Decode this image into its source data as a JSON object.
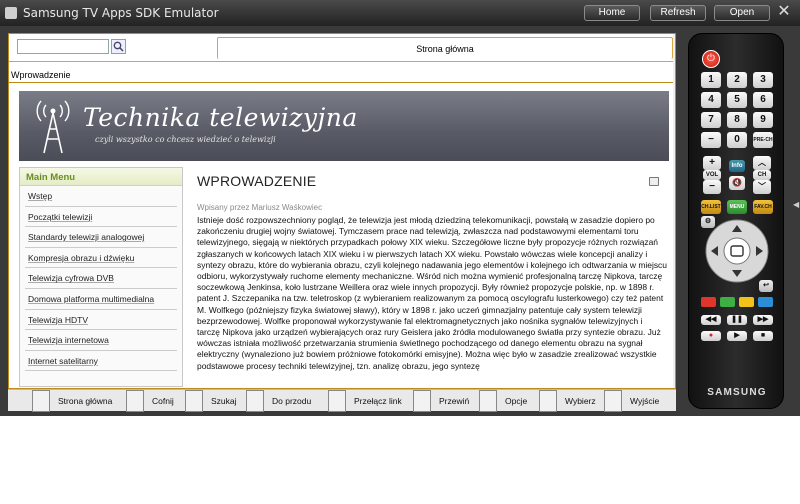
{
  "window": {
    "title": "Samsung TV Apps SDK Emulator",
    "buttons": {
      "home": "Home",
      "refresh": "Refresh",
      "open": "Open",
      "close": "✕"
    }
  },
  "browser": {
    "search": {
      "value": "",
      "placeholder": ""
    },
    "tab": "Strona główna",
    "breadcrumb": "Wprowadzenie"
  },
  "site": {
    "title": "Technika telewizyjna",
    "subtitle": "czyli wszystko co chcesz wiedzieć o telewizji",
    "menu": {
      "heading": "Main Menu",
      "items": [
        "Wstęp",
        "Początki telewizji",
        "Standardy telewizji analogowej",
        "Kompresja obrazu i dźwięku",
        "Telewizja cyfrowa DVB",
        "Domowa platforma multimedialna",
        "Telewizja HDTV",
        "Telewizja internetowa",
        "Internet satelitarny"
      ]
    },
    "article": {
      "heading": "WPROWADZENIE",
      "author": "Wpisany przez Mariusz Waśkowiec",
      "body": "Istnieje dość rozpowszechniony pogląd, że telewizja jest młodą dziedziną telekomunikacji, powstałą w zasadzie dopiero po zakończeniu drugiej wojny światowej. Tymczasem prace nad telewizją, zwłaszcza nad podstawowymi elementami toru telewizyjnego, sięgają w niektórych przypadkach połowy XIX wieku. Szczegółowe liczne były propozycje różnych rozwiązań zgłaszanych w końcowych latach XIX wieku i w pierwszych latach XX wieku. Powstało wówczas wiele koncepcji analizy i syntezy obrazu, które do wybierania obrazu, czyli kolejnego nadawania jego elementów i kolejnego ich odtwarzania w miejscu odbioru, wykorzystywały ruchome elementy mechaniczne. Wśród nich można wymienić profesjonalną tarczę Nipkova, tarczę soczewkową Jenkinsa, koło lustrzane Weillera oraz wiele innych propozycji. Były również propozycje polskie, np. w 1898 r. patent J. Szczepanika na tzw. teletroskop (z wybieraniem realizowanym za pomocą oscylografu lusterkowego) czy też patent M. Wolfkego (późniejszy fizyka światowej sławy), który w 1898 r. jako uczeń gimnazjalny patentuje cały system telewizji bezprzewodowej. Wolfke proponował wykorzystywanie fal elektromagnetycznych jako nośnika sygnałów telewizyjnych i tarczę Nipkova jako urządzeń wybierających oraz rury Geislera jako źródła modulowanego światła przy syntezie obrazu. Już wówczas istniała możliwość przetwarzania strumienia świetlnego pochodzącego od danego elementu obrazu na sygnał elektryczny (wynaleziono już bowiem próżniowe fotokomórki emisyjne). Można więc było w zasadzie zrealizować wszystkie podstawowe procesy techniki telewizyjnej, tzn. analizę obrazu, jego syntezę"
    }
  },
  "function_bar": [
    "Strona główna",
    "Cofnij",
    "Szukaj",
    "Do przodu",
    "Przełącz link",
    "Przewiń",
    "Opcje",
    "Wybierz",
    "Wyjście"
  ],
  "remote": {
    "keys": [
      "1",
      "2",
      "3",
      "4",
      "5",
      "6",
      "7",
      "8",
      "9",
      "−",
      "0",
      "PRE-CH",
      "VOL",
      "CH",
      "Info",
      "CH.LIST",
      "MENU",
      "FAV.CH"
    ],
    "brand": "SAMSUNG",
    "colors": {
      "red": "#e0352b",
      "green": "#3cb043",
      "yellow": "#f2c21a",
      "blue": "#2b8fd8",
      "accent": "#c08a1a"
    }
  }
}
